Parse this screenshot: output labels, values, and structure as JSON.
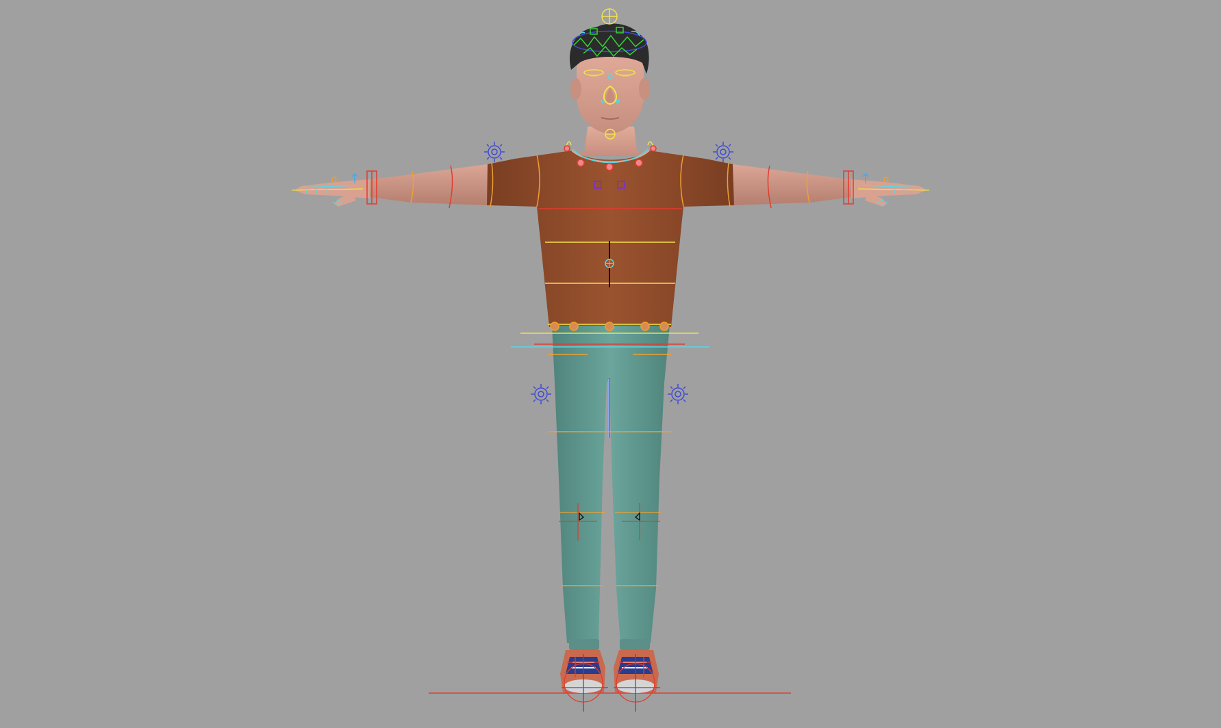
{
  "viewport": {
    "background": "#a0a0a0",
    "character_pose": "T-pose",
    "icons": [
      "gear-icon",
      "crosshair-icon",
      "root-icon"
    ]
  },
  "colors": {
    "skin": "#d79f8e",
    "hair": "#2b2b2b",
    "shirt": "#8e4a2a",
    "pants": "#5f958c",
    "shoe": "#c96a4e",
    "shoe_detail": "#2a3c8e",
    "ctrl_yellow": "#f2e34b",
    "ctrl_orange": "#f0a030",
    "ctrl_red": "#e33b2e",
    "ctrl_blue": "#3f4ad6",
    "ctrl_green": "#36d13a",
    "ctrl_cyan": "#5dd6e2",
    "ctrl_purple": "#7a2fd0"
  }
}
